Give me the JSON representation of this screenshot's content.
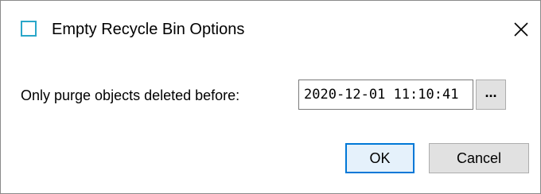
{
  "window": {
    "title": "Empty Recycle Bin Options",
    "icon": "app-window-icon",
    "close_icon": "close-icon"
  },
  "form": {
    "label": "Only purge objects deleted before:",
    "date_value": "2020-12-01 11:10:41",
    "browse_label": "..."
  },
  "buttons": {
    "ok_label": "OK",
    "cancel_label": "Cancel"
  },
  "colors": {
    "accent": "#0078d7",
    "icon_border": "#2aa7c9",
    "button_face": "#e1e1e1",
    "button_border": "#adadad"
  }
}
